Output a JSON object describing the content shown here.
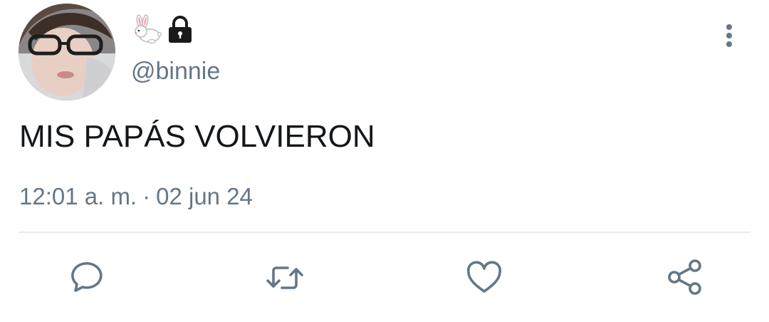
{
  "user": {
    "handle": "@binnie",
    "name_icons": [
      "rabbit-icon",
      "lock-icon"
    ]
  },
  "tweet": {
    "text": "MIS PAPÁS VOLVIERON",
    "time": "12:01 a. m.",
    "separator": "·",
    "date": "02 jun 24"
  },
  "actions": [
    {
      "name": "reply",
      "icon": "speech-bubble-icon"
    },
    {
      "name": "retweet",
      "icon": "retweet-icon"
    },
    {
      "name": "like",
      "icon": "heart-icon"
    },
    {
      "name": "share",
      "icon": "share-icon"
    }
  ],
  "colors": {
    "text": "#14171a",
    "secondary": "#657786",
    "divider": "#e6ecf0",
    "background": "#ffffff"
  }
}
